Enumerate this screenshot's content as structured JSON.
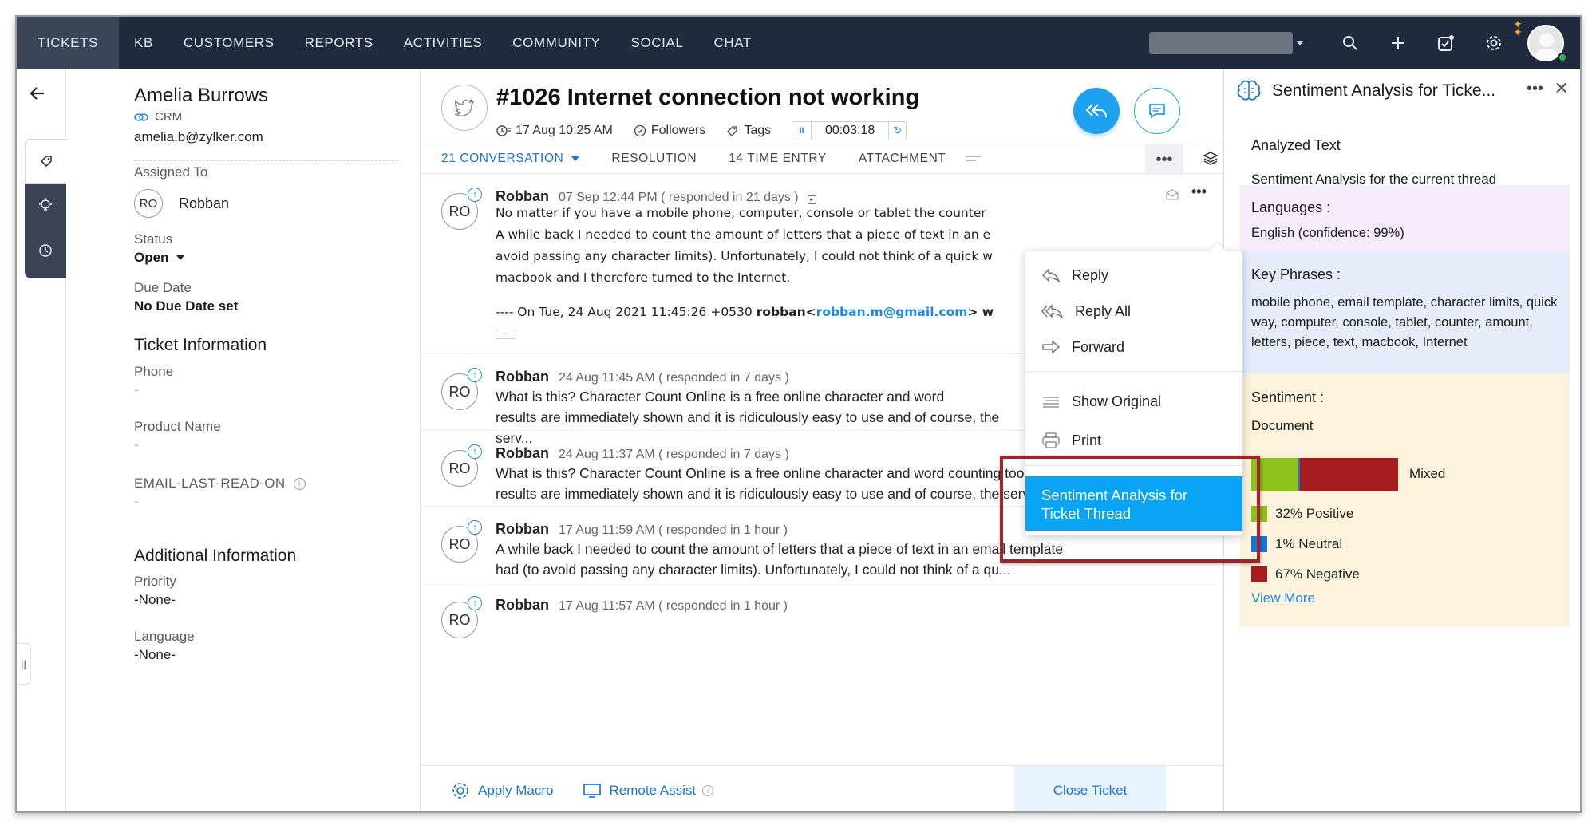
{
  "nav": {
    "items": [
      "TICKETS",
      "KB",
      "CUSTOMERS",
      "REPORTS",
      "ACTIVITIES",
      "COMMUNITY",
      "SOCIAL",
      "CHAT"
    ],
    "active": "TICKETS"
  },
  "contact": {
    "name": "Amelia Burrows",
    "crm_label": "CRM",
    "email": "amelia.b@zylker.com",
    "assigned_to_label": "Assigned To",
    "assignee_initials": "RO",
    "assignee_name": "Robban",
    "status_label": "Status",
    "status_value": "Open",
    "due_label": "Due Date",
    "due_value": "No Due Date set",
    "ticket_info_title": "Ticket Information",
    "phone_label": "Phone",
    "phone_value": "-",
    "product_label": "Product Name",
    "product_value": "-",
    "email_last_label": "EMAIL-LAST-READ-ON",
    "email_last_value": "-",
    "additional_title": "Additional Information",
    "priority_label": "Priority",
    "priority_value": "-None-",
    "language_label": "Language",
    "language_value": "-None-"
  },
  "ticket": {
    "title": "#1026 Internet connection not working",
    "date": "17 Aug 10:25 AM",
    "followers": "Followers",
    "tags": "Tags",
    "timer": "00:03:18"
  },
  "tabs": {
    "conversation": "21  CONVERSATION",
    "resolution": "RESOLUTION",
    "time_entry": "14  TIME ENTRY",
    "attachment": "ATTACHMENT"
  },
  "threads": [
    {
      "initials": "RO",
      "author": "Robban",
      "when": "07 Sep 12:44 PM ( responded in 21 days )",
      "lines": [
        "No matter if you have a mobile phone, computer, console or tablet the counter",
        "A while back I needed to count the amount of letters that a piece of text in an e",
        "avoid passing any character limits). Unfortunately, I could not think of a quick w",
        "macbook and I therefore turned to the Internet."
      ],
      "quote_prefix": "---- On  Tue, 24 Aug 2021 11:45:26 +0530 ",
      "quote_name": "robban<",
      "quote_email": "robban.m@gmail.com",
      "quote_suffix": ">  w"
    },
    {
      "initials": "RO",
      "author": "Robban",
      "when": "24 Aug 11:45 AM ( responded in 7 days )",
      "line1": "What is this? Character Count Online is a free online character and word",
      "line2": "results are immediately shown and it is ridiculously easy to use and of course, the serv..."
    },
    {
      "initials": "RO",
      "author": "Robban",
      "when": "24 Aug 11:37 AM ( responded in 7 days )",
      "line1": "What is this? Character Count Online is a free online character and word counting tool. All",
      "line2": "results are immediately shown and it is ridiculously easy to use and of course, the serv..."
    },
    {
      "initials": "RO",
      "author": "Robban",
      "when": "17 Aug 11:59 AM ( responded in 1 hour )",
      "line1": "A while back I needed to count the amount of letters that a piece of text in an email template",
      "line2": "had (to avoid passing any character limits). Unfortunately, I could not think of a qu..."
    },
    {
      "initials": "RO",
      "author": "Robban",
      "when": "17 Aug 11:57 AM ( responded in 1 hour )"
    }
  ],
  "menu": {
    "reply": "Reply",
    "reply_all": "Reply All",
    "forward": "Forward",
    "show_original": "Show Original",
    "print": "Print",
    "sentiment": "Sentiment Analysis for Ticket Thread"
  },
  "bottom": {
    "apply_macro": "Apply Macro",
    "remote_assist": "Remote Assist",
    "close_ticket": "Close Ticket"
  },
  "panel": {
    "title": "Sentiment Analysis for Ticke...",
    "analyzed_title": "Analyzed Text",
    "analyzed_desc": "Sentiment Analysis for the current thread",
    "languages_title": "Languages :",
    "languages_value": "English  (confidence: 99%)",
    "key_phrases_title": "Key Phrases :",
    "key_phrases_value": "mobile phone, email template, character limits, quick way, computer, console, tablet, counter, amount, letters, piece, text, macbook, Internet",
    "sentiment_title": "Sentiment :",
    "document_label": "Document",
    "overall": "Mixed",
    "breakdown": [
      {
        "label": "32% Positive",
        "value": 32,
        "color": "#8bc21b"
      },
      {
        "label": "1% Neutral",
        "value": 1,
        "color": "#1b74d1"
      },
      {
        "label": "67% Negative",
        "value": 67,
        "color": "#a41c1c"
      }
    ],
    "view_more": "View More",
    "colors": {
      "languages_bg": "#f7ecfb",
      "key_phrases_bg": "#e4edf9",
      "sentiment_bg": "#fdf3dd"
    }
  }
}
